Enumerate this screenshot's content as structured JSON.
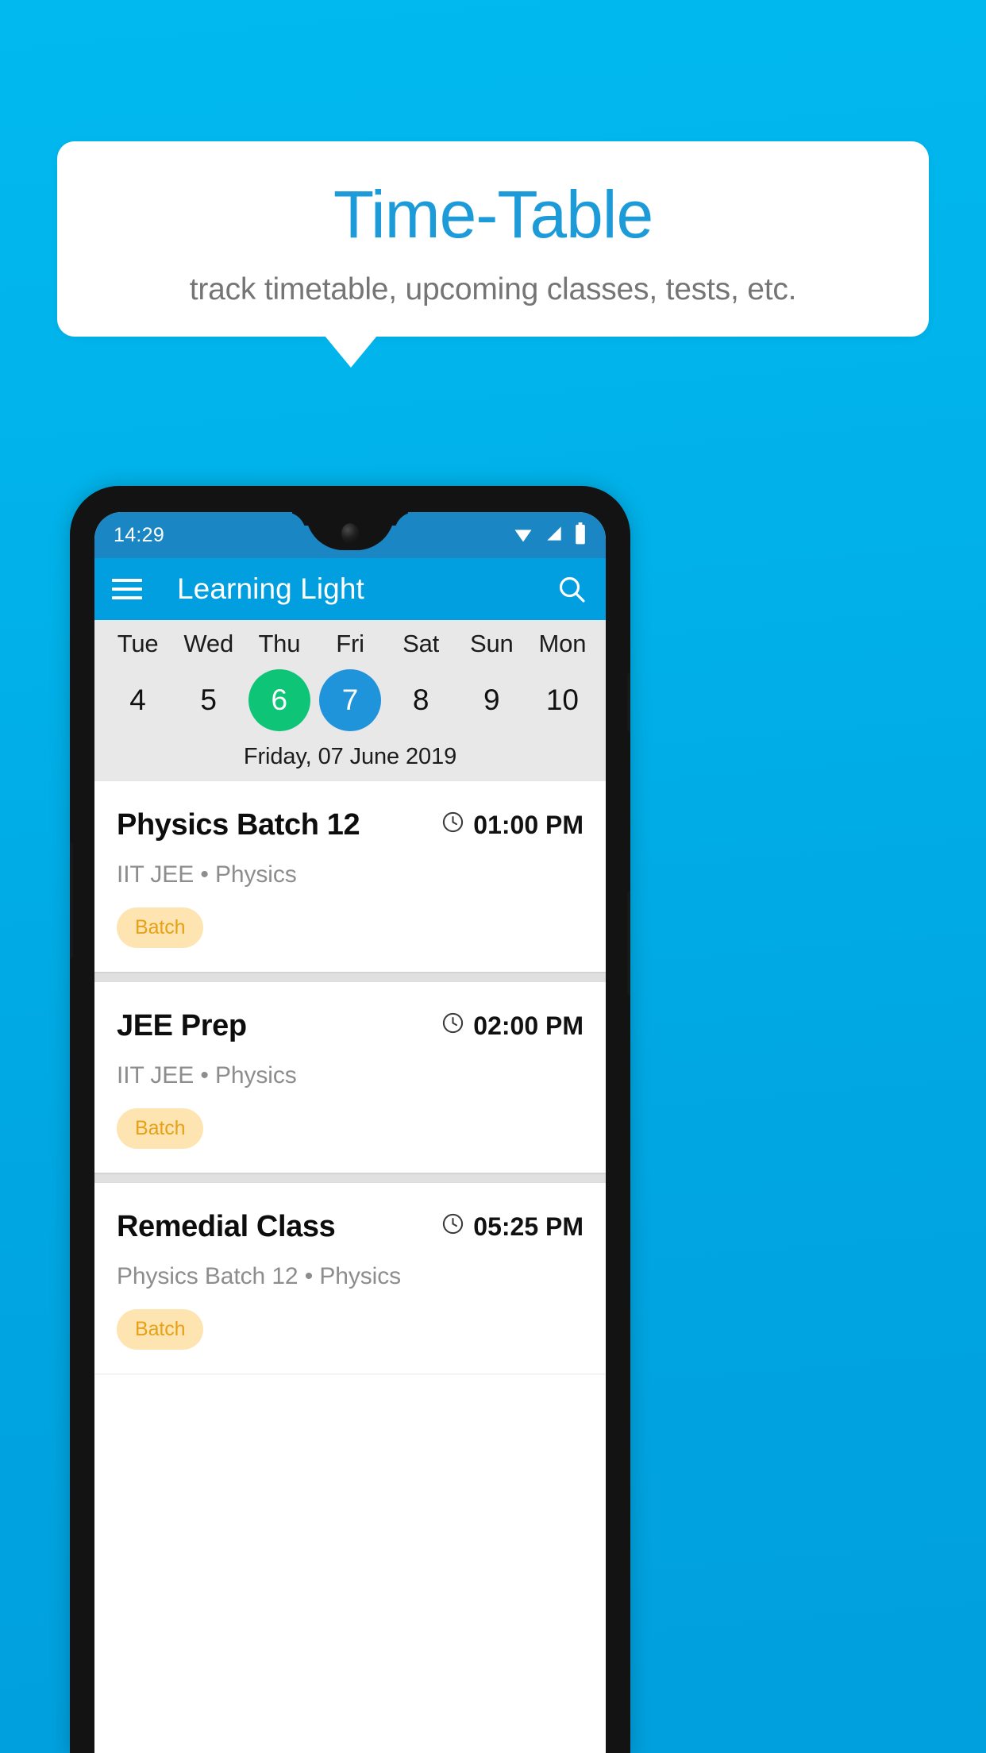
{
  "banner": {
    "title": "Time-Table",
    "subtitle": "track timetable, upcoming classes, tests, etc.",
    "title_color": "#1c9bd8",
    "background_color": "#01b2ea"
  },
  "phone": {
    "status_bar": {
      "time": "14:29",
      "icons": [
        "wifi-icon",
        "signal-icon",
        "battery-icon"
      ],
      "background_color": "#1a86c3"
    },
    "app_bar": {
      "menu_icon": "hamburger-menu-icon",
      "title": "Learning Light",
      "search_icon": "search-icon",
      "background_color": "#029fe0"
    },
    "day_strip": {
      "background_color": "#e8e8e8",
      "days": [
        {
          "name": "Tue",
          "num": "4",
          "state": "normal"
        },
        {
          "name": "Wed",
          "num": "5",
          "state": "normal"
        },
        {
          "name": "Thu",
          "num": "6",
          "state": "today"
        },
        {
          "name": "Fri",
          "num": "7",
          "state": "selected"
        },
        {
          "name": "Sat",
          "num": "8",
          "state": "normal"
        },
        {
          "name": "Sun",
          "num": "9",
          "state": "normal"
        },
        {
          "name": "Mon",
          "num": "10",
          "state": "normal"
        }
      ],
      "today_color": "#0ec477",
      "selected_color": "#1f94db",
      "date_label": "Friday, 07 June 2019"
    },
    "events": [
      {
        "title": "Physics Batch 12",
        "time": "01:00 PM",
        "subtitle": "IIT JEE • Physics",
        "chip": "Batch",
        "clock_icon": "clock-icon"
      },
      {
        "title": "JEE Prep",
        "time": "02:00 PM",
        "subtitle": "IIT JEE • Physics",
        "chip": "Batch",
        "clock_icon": "clock-icon"
      },
      {
        "title": "Remedial Class",
        "time": "05:25 PM",
        "subtitle": "Physics Batch 12 • Physics",
        "chip": "Batch",
        "clock_icon": "clock-icon"
      }
    ],
    "chip_bg_color": "#fde4b0",
    "chip_text_color": "#e6a117"
  }
}
